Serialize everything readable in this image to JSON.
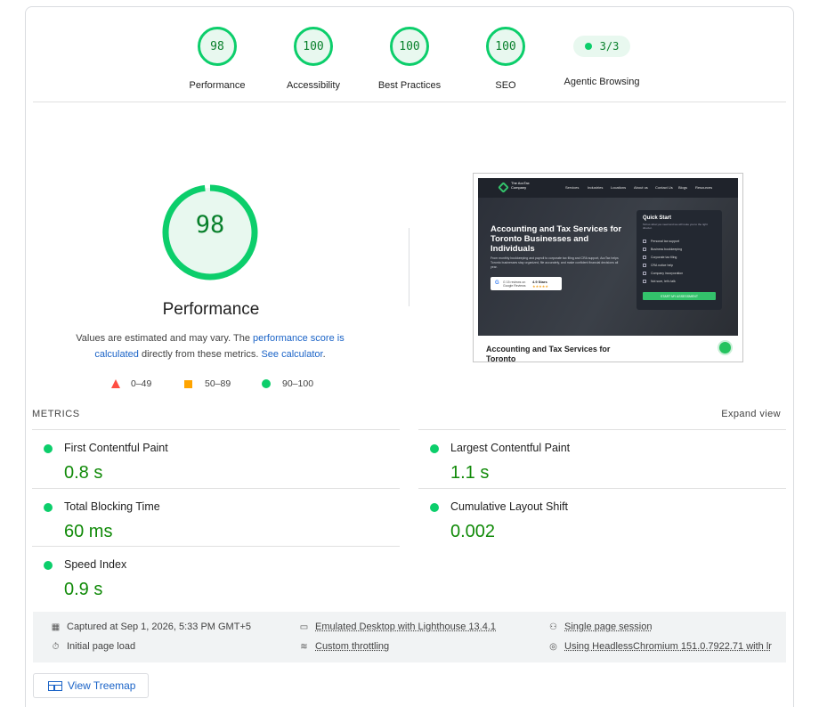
{
  "gauges": [
    {
      "score": "98",
      "label": "Performance"
    },
    {
      "score": "100",
      "label": "Accessibility"
    },
    {
      "score": "100",
      "label": "Best Practices"
    },
    {
      "score": "100",
      "label": "SEO"
    }
  ],
  "agentic": {
    "value": "3/3",
    "label": "Agentic Browsing"
  },
  "main": {
    "score": "98",
    "score_fraction": 0.98,
    "title": "Performance",
    "note_prefix": "Values are estimated and may vary. The ",
    "note_link1": "performance score is calculated",
    "note_mid": " directly from these metrics. ",
    "note_link2": "See calculator",
    "note_suffix": "."
  },
  "legend": {
    "poor": "0–49",
    "average": "50–89",
    "good": "90–100"
  },
  "thumbnail": {
    "logo": "The AccTax Company",
    "nav": [
      "Services",
      "Industries",
      "Locations",
      "About us",
      "Contact Us",
      "Blogs",
      "Resources"
    ],
    "headline": "Accounting and Tax Services for Toronto Businesses and Individuals",
    "subtext": "From monthly bookkeeping and payroll to corporate tax filing and CRA support, AccTax helps Toronto businesses stay organized, file accurately, and make confident financial decisions all year.",
    "reviews": "G 15 reviews on Google Reviews",
    "rating": "4.9 Stars",
    "quick_start_title": "Quick Start",
    "quick_start_desc": "Tell us what you need and we will route you to the right director.",
    "options": [
      "Personal tax support",
      "Business bookkeeping",
      "Corporate tax filing",
      "CRA notice help",
      "Company incorporation",
      "Not sure, let's talk"
    ],
    "cta": "START MY ASSESSMENT",
    "below": "Accounting and Tax Services for Toronto"
  },
  "metrics": {
    "header": "METRICS",
    "expand": "Expand view",
    "items": [
      {
        "name": "First Contentful Paint",
        "value": "0.8 s"
      },
      {
        "name": "Largest Contentful Paint",
        "value": "1.1 s"
      },
      {
        "name": "Total Blocking Time",
        "value": "60 ms"
      },
      {
        "name": "Cumulative Layout Shift",
        "value": "0.002"
      },
      {
        "name": "Speed Index",
        "value": "0.9 s"
      }
    ]
  },
  "runtime": {
    "captured": "Captured at Sep 1, 2026, 5:33 PM GMT+5",
    "emulated": "Emulated Desktop with Lighthouse 13.4.1",
    "session": "Single page session",
    "initial": "Initial page load",
    "throttling": "Custom throttling",
    "browser": "Using HeadlessChromium 151.0.7922.71 with lr"
  },
  "treemap": "View Treemap",
  "colors": {
    "pass": "#0cce6b",
    "pass_text": "#08802b",
    "average": "#ffa400",
    "fail": "#ff4e42",
    "link": "#1a63c7"
  }
}
